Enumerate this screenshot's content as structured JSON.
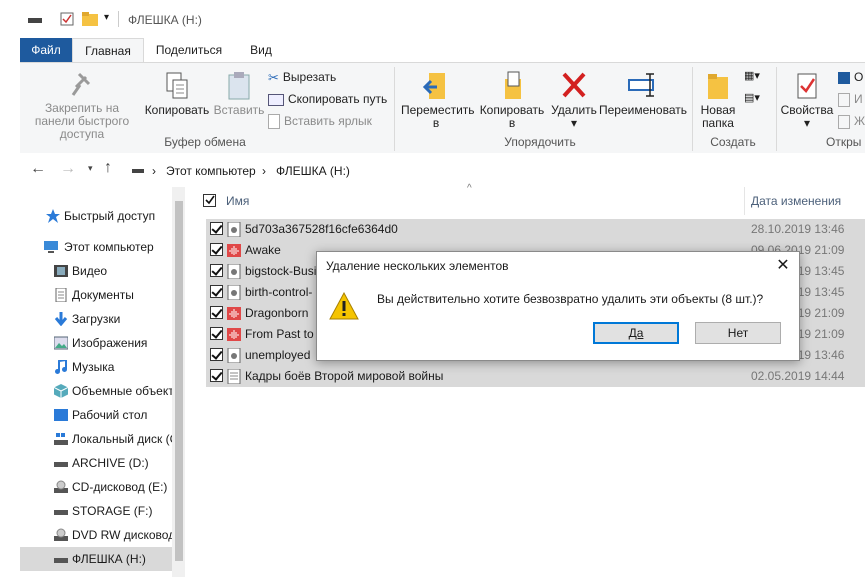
{
  "window": {
    "title": "ФЛЕШКА (H:)"
  },
  "tabs": {
    "file": "Файл",
    "home": "Главная",
    "share": "Поделиться",
    "view": "Вид"
  },
  "ribbon": {
    "pin": "Закрепить на панели быстрого доступа",
    "copy": "Копировать",
    "paste": "Вставить",
    "cut": "Вырезать",
    "copy_path": "Скопировать путь",
    "paste_shortcut": "Вставить ярлык",
    "group_clipboard": "Буфер обмена",
    "move_to": "Переместить в",
    "copy_to": "Копировать в",
    "delete": "Удалить",
    "rename": "Переименовать",
    "group_organize": "Упорядочить",
    "new_folder": "Новая папка",
    "group_new": "Создать",
    "properties": "Свойства",
    "group_open": "Откры",
    "open_small_1": "О",
    "open_small_2": "И",
    "open_small_3": "Ж"
  },
  "address": {
    "computer": "Этот компьютер",
    "drive": "ФЛЕШКА (H:)"
  },
  "nav": {
    "items": [
      {
        "label": "Быстрый доступ"
      },
      {
        "label": "Этот компьютер"
      },
      {
        "label": "Видео"
      },
      {
        "label": "Документы"
      },
      {
        "label": "Загрузки"
      },
      {
        "label": "Изображения"
      },
      {
        "label": "Музыка"
      },
      {
        "label": "Объемные объекты"
      },
      {
        "label": "Рабочий стол"
      },
      {
        "label": "Локальный диск (C:)"
      },
      {
        "label": "ARCHIVE (D:)"
      },
      {
        "label": "CD-дисковод (E:)"
      },
      {
        "label": "STORAGE (F:)"
      },
      {
        "label": "DVD RW дисковод"
      },
      {
        "label": "ФЛЕШКА (H:)"
      }
    ]
  },
  "files": {
    "col_name": "Имя",
    "col_date": "Дата изменения",
    "rows": [
      {
        "name": "5d703a367528f16cfe6364d0",
        "date": "28.10.2019 13:46"
      },
      {
        "name": "Awake",
        "date": "09.06.2019 21:09"
      },
      {
        "name": "bigstock-Business",
        "date": "28.10.2019 13:45"
      },
      {
        "name": "birth-control-",
        "date": "28.10.2019 13:45"
      },
      {
        "name": "Dragonborn",
        "date": "09.06.2019 21:09"
      },
      {
        "name": "From Past to",
        "date": "09.06.2019 21:09"
      },
      {
        "name": "unemployed",
        "date": "28.10.2019 13:46"
      },
      {
        "name": "Кадры боёв Второй мировой войны",
        "date": "02.05.2019 14:44"
      }
    ]
  },
  "dialog": {
    "title": "Удаление нескольких элементов",
    "message": "Вы действительно хотите безвозвратно удалить эти объекты (8 шт.)?",
    "yes": "Да",
    "no": "Нет"
  },
  "colors": {
    "accent": "#1e5a9e",
    "selection": "#d9d9d9",
    "focus": "#0078d7"
  }
}
